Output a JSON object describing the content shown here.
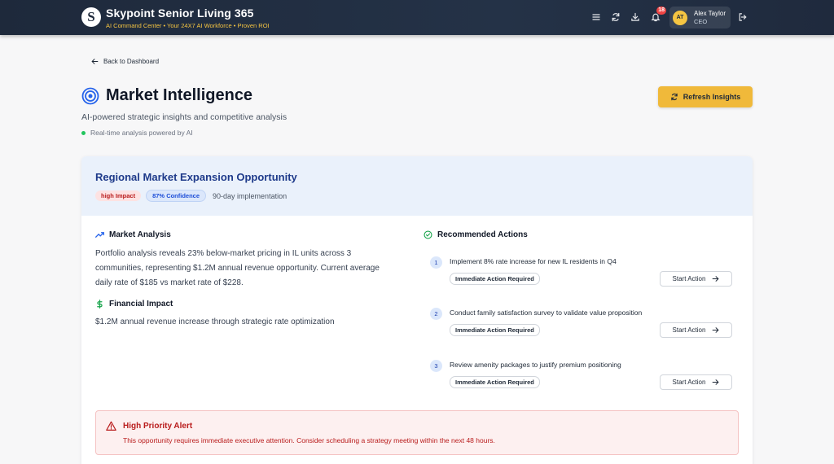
{
  "header": {
    "logo_letter": "S",
    "title": "Skypoint Senior Living 365",
    "subtitle": "AI Command Center • Your 24X7 AI Workforce • Proven ROI",
    "notifications_count": "18",
    "user": {
      "initials": "AT",
      "name": "Alex Taylor",
      "role": "CEO"
    },
    "icons": [
      "menu-icon",
      "refresh-icon",
      "download-icon",
      "bell-icon",
      "logout-icon"
    ]
  },
  "page": {
    "back_label": "Back to Dashboard",
    "title": "Market Intelligence",
    "subtitle": "AI-powered strategic insights and competitive analysis",
    "live_status": "Real-time analysis powered by AI",
    "refresh_label": "Refresh Insights"
  },
  "card": {
    "title": "Regional Market Expansion Opportunity",
    "impact_badge": "high Impact",
    "confidence_badge": "87% Confidence",
    "timeline": "90-day implementation",
    "market_analysis": {
      "heading": "Market Analysis",
      "text_lines": [
        "Portfolio analysis reveals 23% below-market pricing in IL units across 3",
        "communities, representing $1.2M annual revenue opportunity. Current average",
        "daily rate of $185 vs market rate of $228."
      ]
    },
    "financial_impact": {
      "heading": "Financial Impact",
      "text": "$1.2M annual revenue increase through strategic rate optimization"
    },
    "recommended_actions": {
      "heading": "Recommended Actions",
      "items": [
        {
          "num": "1",
          "text": "Implement 8% rate increase for new IL residents in Q4",
          "tag": "Immediate Action Required",
          "button": "Start Action"
        },
        {
          "num": "2",
          "text": "Conduct family satisfaction survey to validate value proposition",
          "tag": "Immediate Action Required",
          "button": "Start Action"
        },
        {
          "num": "3",
          "text": "Review amenity packages to justify premium positioning",
          "tag": "Immediate Action Required",
          "button": "Start Action"
        }
      ]
    },
    "alert": {
      "title": "High Priority Alert",
      "text": "This opportunity requires immediate executive attention. Consider scheduling a strategy meeting within the next 48 hours."
    }
  },
  "colors": {
    "header_bg": "#1e293b",
    "accent_gold": "#f0b93a",
    "card_title_blue": "#1e3a8a",
    "alert_red": "#b91c1c",
    "live_green": "#22c55e"
  }
}
